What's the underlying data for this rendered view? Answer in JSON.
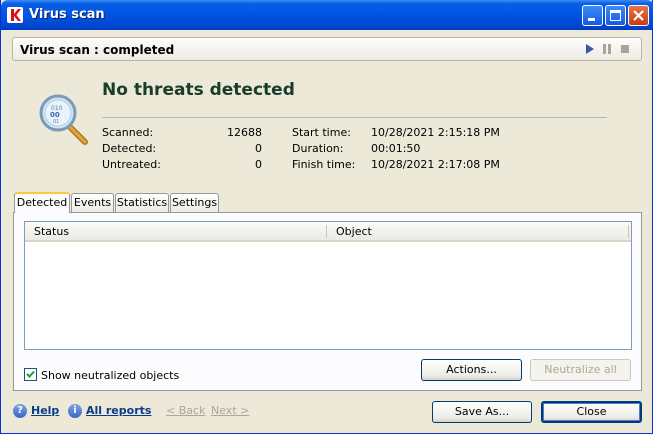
{
  "window": {
    "title": "Virus scan",
    "icon": "kaspersky-logo",
    "controls": [
      "minimize",
      "maximize",
      "close"
    ]
  },
  "status_bar": {
    "text": "Virus scan : completed",
    "controls": [
      "play-icon",
      "pause-icon",
      "stop-icon"
    ]
  },
  "summary": {
    "headline": "No threats detected",
    "scanned_label": "Scanned:",
    "scanned_value": "12688",
    "detected_label": "Detected:",
    "detected_value": "0",
    "untreated_label": "Untreated:",
    "untreated_value": "0",
    "start_label": "Start time:",
    "start_value": "10/28/2021 2:15:18 PM",
    "duration_label": "Duration:",
    "duration_value": "00:01:50",
    "finish_label": "Finish time:",
    "finish_value": "10/28/2021 2:17:08 PM"
  },
  "tabs": [
    {
      "label": "Detected",
      "active": true
    },
    {
      "label": "Events",
      "active": false
    },
    {
      "label": "Statistics",
      "active": false
    },
    {
      "label": "Settings",
      "active": false
    }
  ],
  "grid": {
    "columns": [
      "Status",
      "Object"
    ],
    "rows": []
  },
  "show_neutralized": {
    "label": "Show neutralized objects",
    "checked": true
  },
  "buttons": {
    "actions": "Actions...",
    "neutralize_all": "Neutralize all",
    "save_as": "Save As...",
    "close": "Close"
  },
  "footer": {
    "help": "Help",
    "all_reports": "All reports",
    "back": "< Back",
    "next": "Next >"
  },
  "colors": {
    "titlebar": "#0054e3",
    "background": "#ece9d8",
    "headline": "#1a3c2a"
  }
}
